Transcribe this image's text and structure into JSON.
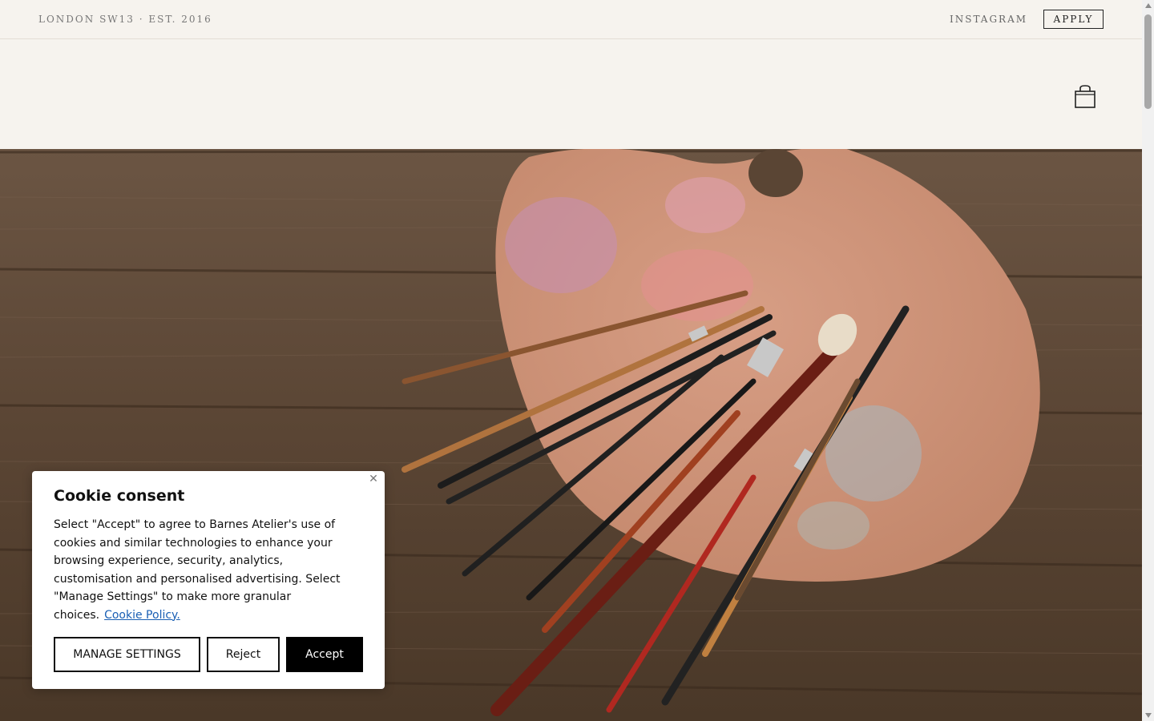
{
  "topbar": {
    "location": "LONDON SW13 · EST. 2016",
    "instagram": "INSTAGRAM",
    "apply": "APPLY"
  },
  "header": {
    "cart_icon": "shopping-bag-icon"
  },
  "hero": {
    "image": "paint-palette-with-brushes-on-wooden-table"
  },
  "cookie": {
    "title": "Cookie consent",
    "body": "Select \"Accept\" to agree to Barnes Atelier's use of cookies and similar technologies to enhance your browsing experience, security, analytics, customisation and personalised advertising. Select \"Manage Settings\" to make more granular choices.",
    "policy_link": "Cookie Policy.",
    "close_icon": "close-icon",
    "manage_label": "MANAGE SETTINGS",
    "reject_label": "Reject",
    "accept_label": "Accept"
  },
  "colors": {
    "background": "#f6f3ee",
    "text_dark": "#111111",
    "link": "#1a5fb4",
    "accept_bg": "#000000"
  }
}
